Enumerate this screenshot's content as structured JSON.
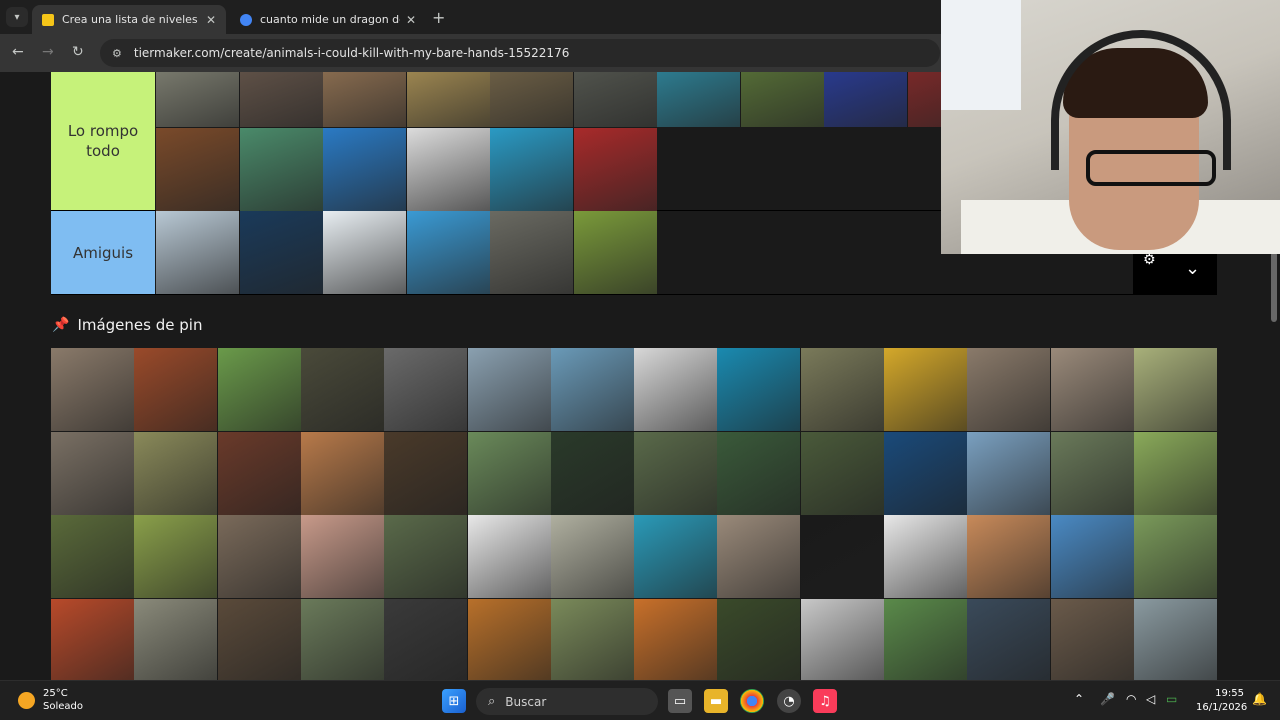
{
  "browser": {
    "tabs": [
      {
        "title": "Crea una lista de niveles de animales",
        "favicon_color": "#f5c518",
        "active": true
      },
      {
        "title": "cuanto mide un dragon de komodo",
        "favicon_color": "#4285f4",
        "active": false
      }
    ],
    "url": "tiermaker.com/create/animals-i-could-kill-with-my-bare-hands-15522176"
  },
  "tiers": [
    {
      "label": "Lo rompo todo",
      "color": "#c6f27a",
      "tiles": [
        {
          "name": "donkey",
          "color": "#8a8b7c"
        },
        {
          "name": "wolverine",
          "color": "#6b5a4e"
        },
        {
          "name": "kangaroo",
          "color": "#9c7a58"
        },
        {
          "name": "platypus",
          "color": "#b59a5a"
        },
        {
          "name": "armadillo",
          "color": "#7a6a4c"
        },
        {
          "name": "lemur",
          "color": "#5a5d55"
        },
        {
          "name": "grouper",
          "color": "#2f8ea6"
        },
        {
          "name": "rooster",
          "color": "#5e7a3a"
        },
        {
          "name": "octopus",
          "color": "#2a3fa4"
        },
        {
          "name": "fruit",
          "color": "#8a2a2a"
        },
        {
          "name": "centipede",
          "color": "#7a4a2a"
        },
        {
          "name": "pufferfish",
          "color": "#4a8a6a"
        },
        {
          "name": "narwhal",
          "color": "#2a7ac4"
        },
        {
          "name": "scorpion",
          "color": "#dcdcdc"
        },
        {
          "name": "seahorse",
          "color": "#2a9ac4"
        },
        {
          "name": "sea-urchin",
          "color": "#a82a2a"
        }
      ]
    },
    {
      "label": "Amiguis",
      "color": "#7fbdf2",
      "tiles": [
        {
          "name": "penguin",
          "color": "#b8c8d4"
        },
        {
          "name": "orca",
          "color": "#1a3a5a"
        },
        {
          "name": "dolphin",
          "color": "#e8eef2"
        },
        {
          "name": "man",
          "color": "#3a9ad4"
        },
        {
          "name": "seal",
          "color": "#6a6a62"
        },
        {
          "name": "bernese-dog",
          "color": "#7a9a3a"
        }
      ]
    }
  ],
  "pin_section": {
    "title": "Imágenes de pin",
    "tiles": [
      {
        "name": "honey-badger",
        "color": "#8a7a6a"
      },
      {
        "name": "orangutan",
        "color": "#9a4a2a"
      },
      {
        "name": "cow",
        "color": "#6a9a4a"
      },
      {
        "name": "bull",
        "color": "#4a4a3a"
      },
      {
        "name": "raccoon",
        "color": "#6a6a6a"
      },
      {
        "name": "deer",
        "color": "#8aa0b0"
      },
      {
        "name": "heron",
        "color": "#6a9ab8"
      },
      {
        "name": "condor",
        "color": "#d8d8d8"
      },
      {
        "name": "sea-turtle",
        "color": "#1a8ab0"
      },
      {
        "name": "iguana",
        "color": "#7a7a5a"
      },
      {
        "name": "blue-ringed-octopus",
        "color": "#d4a82a"
      },
      {
        "name": "tasmanian-devil",
        "color": "#8a7a6a"
      },
      {
        "name": "rattlesnake",
        "color": "#9a8a7a"
      },
      {
        "name": "weasel",
        "color": "#a8b07a"
      },
      {
        "name": "skunk",
        "color": "#7a7064"
      },
      {
        "name": "zebra",
        "color": "#8a8a5a"
      },
      {
        "name": "piranha",
        "color": "#6a3a2a"
      },
      {
        "name": "fire-ants",
        "color": "#b87a4a"
      },
      {
        "name": "mammoth",
        "color": "#4a3a2a"
      },
      {
        "name": "koala",
        "color": "#6a8a5a"
      },
      {
        "name": "gorilla",
        "color": "#2a3a2a"
      },
      {
        "name": "sloth",
        "color": "#5a6a4a"
      },
      {
        "name": "tortoise",
        "color": "#3a5a3a"
      },
      {
        "name": "porcupine",
        "color": "#4a5a3a"
      },
      {
        "name": "blue-whale",
        "color": "#1a4a7a"
      },
      {
        "name": "camel",
        "color": "#7aa0c0"
      },
      {
        "name": "t-rex",
        "color": "#6a7a5a"
      },
      {
        "name": "llama",
        "color": "#8aaa5a"
      },
      {
        "name": "mastiff",
        "color": "#5a6a3a"
      },
      {
        "name": "rottweiler",
        "color": "#8aa04a"
      },
      {
        "name": "dried-earth",
        "color": "#7a6a5a"
      },
      {
        "name": "pig",
        "color": "#c89a8a"
      },
      {
        "name": "peacock",
        "color": "#5a6a4a"
      },
      {
        "name": "parasaurolophus",
        "color": "#e8e8e8"
      },
      {
        "name": "stingray",
        "color": "#b0b0a0"
      },
      {
        "name": "manta-ray",
        "color": "#2a9ab8"
      },
      {
        "name": "emu",
        "color": "#9a8a7a"
      },
      {
        "name": "velociraptor",
        "color": "#1a1a1a"
      },
      {
        "name": "dimetrodon",
        "color": "#e8e8e8"
      },
      {
        "name": "armadillo-2",
        "color": "#c88a5a"
      },
      {
        "name": "iguanodon",
        "color": "#4a8ac4"
      },
      {
        "name": "donkey-2",
        "color": "#7a9a5a"
      },
      {
        "name": "kentrosaurus",
        "color": "#b84a2a"
      },
      {
        "name": "stegosaurus",
        "color": "#8a8a7a"
      },
      {
        "name": "bigfoot",
        "color": "#5a4a3a"
      },
      {
        "name": "ankylosaurus",
        "color": "#6a7a5a"
      },
      {
        "name": "frilled-lizard",
        "color": "#3a3a3a"
      },
      {
        "name": "tiger",
        "color": "#b8702a"
      },
      {
        "name": "capybara",
        "color": "#7a8a5a"
      },
      {
        "name": "fox",
        "color": "#c8702a"
      },
      {
        "name": "crab",
        "color": "#3a4a2a"
      },
      {
        "name": "cobra",
        "color": "#c8c8c8"
      },
      {
        "name": "hedgehog",
        "color": "#5a8a4a"
      },
      {
        "name": "moose",
        "color": "#3a4a5a"
      },
      {
        "name": "wombat",
        "color": "#6a5a4a"
      },
      {
        "name": "elk",
        "color": "#8a9aa0"
      }
    ]
  },
  "taskbar": {
    "temperature": "25°C",
    "weather": "Soleado",
    "search_placeholder": "Buscar",
    "time": "19:55",
    "date": "16/1/2026"
  }
}
